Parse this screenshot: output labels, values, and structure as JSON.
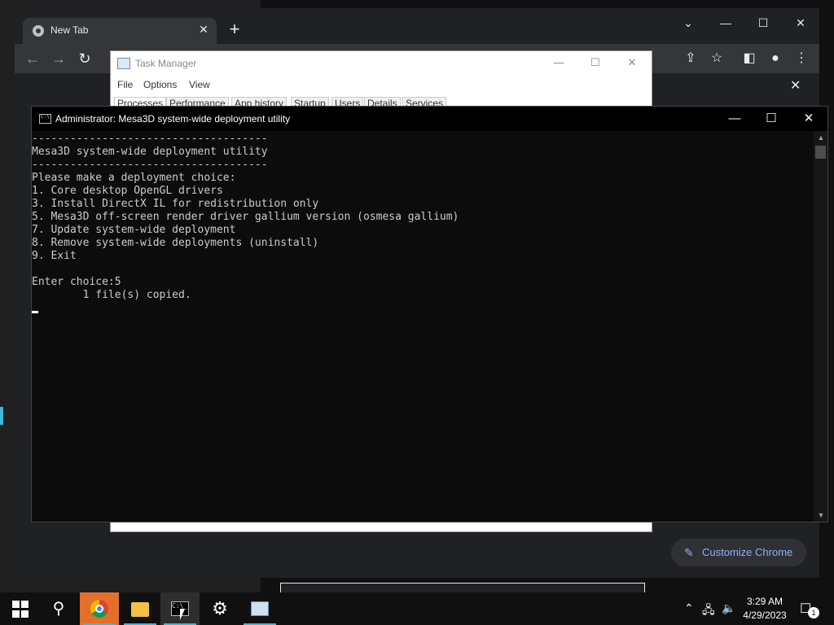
{
  "chrome": {
    "tab_title": "New Tab",
    "tab_close": "✕",
    "new_tab": "+",
    "customize_label": "Customize Chrome"
  },
  "task_manager": {
    "title": "Task Manager",
    "menu": [
      "File",
      "Options",
      "View"
    ],
    "tabs": [
      "Processes",
      "Performance",
      "App history",
      "Startup",
      "Users",
      "Details",
      "Services"
    ]
  },
  "cmd": {
    "title": "Administrator:  Mesa3D system-wide deployment utility",
    "lines": [
      "-------------------------------------",
      "Mesa3D system-wide deployment utility",
      "-------------------------------------",
      "Please make a deployment choice:",
      "1. Core desktop OpenGL drivers",
      "3. Install DirectX IL for redistribution only",
      "5. Mesa3D off-screen render driver gallium version (osmesa gallium)",
      "7. Update system-wide deployment",
      "8. Remove system-wide deployments (uninstall)",
      "9. Exit",
      "",
      "Enter choice:5",
      "        1 file(s) copied.",
      ""
    ]
  },
  "taskbar": {
    "time": "3:29 AM",
    "date": "4/29/2023",
    "notification_count": "1"
  },
  "colors": {
    "taskbar_accent": "#3fb8d8",
    "chrome_link": "#8ab4f8"
  }
}
